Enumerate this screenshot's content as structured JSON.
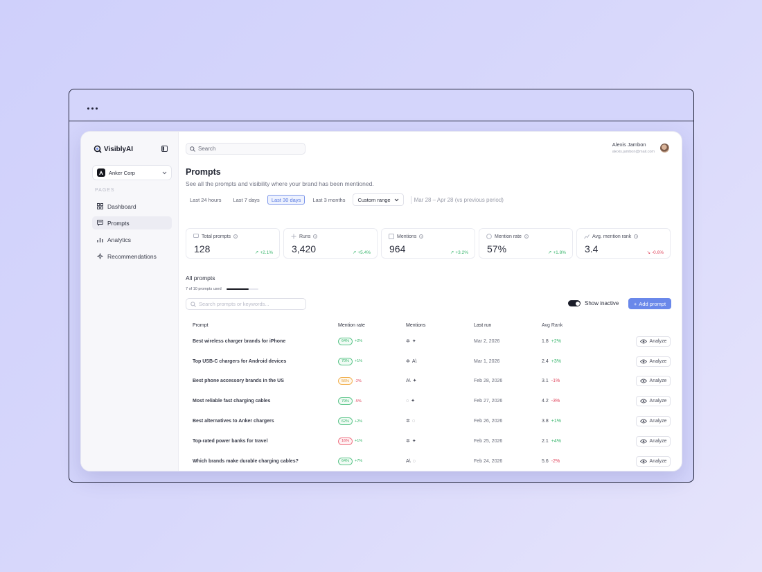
{
  "app": {
    "brand": "VisiblyAI"
  },
  "sidebar": {
    "org": "Anker Corp",
    "pages_label": "PAGES",
    "items": [
      {
        "label": "Dashboard",
        "icon": "dashboard-icon"
      },
      {
        "label": "Prompts",
        "icon": "prompts-icon",
        "active": true
      },
      {
        "label": "Analytics",
        "icon": "analytics-icon"
      },
      {
        "label": "Recommendations",
        "icon": "sparkle-icon"
      }
    ]
  },
  "header": {
    "search_placeholder": "Search",
    "user_name": "Alexis Jambon",
    "user_email": "alexis.jambon@mail.com"
  },
  "page": {
    "title": "Prompts",
    "subtitle": "See all the prompts and visibility where your brand has been mentioned."
  },
  "ranges": {
    "options": [
      "Last 24 hours",
      "Last 7 days",
      "Last 30 days",
      "Last 3 months"
    ],
    "active": "Last 30 days",
    "custom_label": "Custom range",
    "period": "Mar 28 – Apr 28 (vs previous period)"
  },
  "stats": [
    {
      "label": "Total prompts",
      "value": "128",
      "delta": "+2.1%",
      "dir": "up"
    },
    {
      "label": "Runs",
      "value": "3,420",
      "delta": "+5.4%",
      "dir": "up"
    },
    {
      "label": "Mentions",
      "value": "964",
      "delta": "+3.2%",
      "dir": "up"
    },
    {
      "label": "Mention rate",
      "value": "57%",
      "delta": "+1.8%",
      "dir": "up"
    },
    {
      "label": "Avg. mention rank",
      "value": "3.4",
      "delta": "-0.6%",
      "dir": "down"
    }
  ],
  "prompts_section": {
    "title": "All prompts",
    "usage_text": "7 of 10 prompts used",
    "usage_fraction": 0.7,
    "filter_placeholder": "Search prompts or keywords...",
    "show_inactive_label": "Show inactive",
    "add_label": "Add prompt"
  },
  "table": {
    "columns": [
      "Prompt",
      "Mention rate",
      "Mentions",
      "Last run",
      "Avg Rank",
      ""
    ],
    "analyze_label": "Analyze",
    "rows": [
      {
        "prompt": "Best wireless charger brands for iPhone",
        "rate": "64%",
        "rate_color": "green",
        "rate_delta": "+2%",
        "mentions": [
          "✲",
          "✦"
        ],
        "last_run": "Mar 2, 2026",
        "rank": "1.8",
        "rank_delta": "+2%"
      },
      {
        "prompt": "Top USB-C chargers for Android devices",
        "rate": "70%",
        "rate_color": "green",
        "rate_delta": "+1%",
        "mentions": [
          "✲",
          "A\\"
        ],
        "last_run": "Mar 1, 2026",
        "rank": "2.4",
        "rank_delta": "+3%"
      },
      {
        "prompt": "Best phone accessory brands in the US",
        "rate": "56%",
        "rate_color": "orange",
        "rate_delta": "-2%",
        "mentions": [
          "A\\",
          "✦"
        ],
        "last_run": "Feb 28, 2026",
        "rank": "3.1",
        "rank_delta": "-1%"
      },
      {
        "prompt": "Most reliable fast charging cables",
        "rate": "79%",
        "rate_color": "green",
        "rate_delta": "-5%",
        "mentions": [
          "◌",
          "✦"
        ],
        "last_run": "Feb 27, 2026",
        "rank": "4.2",
        "rank_delta": "-3%"
      },
      {
        "prompt": "Best alternatives to Anker chargers",
        "rate": "62%",
        "rate_color": "green",
        "rate_delta": "+2%",
        "mentions": [
          "✲",
          "◌"
        ],
        "last_run": "Feb 26, 2026",
        "rank": "3.8",
        "rank_delta": "+1%"
      },
      {
        "prompt": "Top-rated power banks for travel",
        "rate": "16%",
        "rate_color": "red",
        "rate_delta": "+1%",
        "mentions": [
          "✲",
          "✦"
        ],
        "last_run": "Feb 25, 2026",
        "rank": "2.1",
        "rank_delta": "+4%"
      },
      {
        "prompt": "Which brands make durable charging cables?",
        "rate": "64%",
        "rate_color": "green",
        "rate_delta": "+7%",
        "mentions": [
          "A\\",
          "◌"
        ],
        "last_run": "Feb 24, 2026",
        "rank": "5.6",
        "rank_delta": "-2%"
      }
    ]
  }
}
